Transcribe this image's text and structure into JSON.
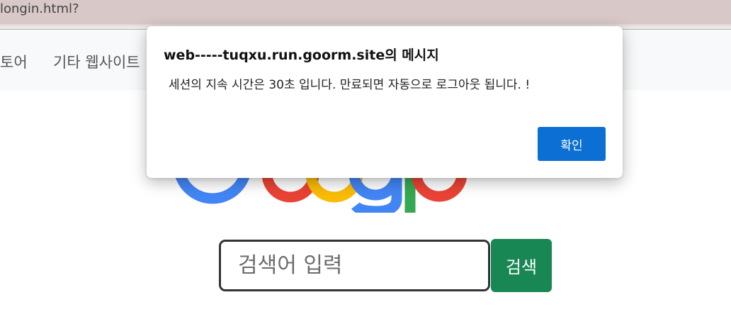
{
  "browser": {
    "address_text": "longin.html?"
  },
  "navbar": {
    "items": [
      {
        "label": "토어"
      },
      {
        "label": "기타 웹사이트"
      }
    ]
  },
  "logo": {
    "name": "Google",
    "colors": {
      "blue": "#4285F4",
      "red": "#EA4335",
      "yellow": "#FBBC05",
      "green": "#34A853"
    }
  },
  "search": {
    "placeholder": "검색어 입력",
    "value": "",
    "button_label": "검색",
    "button_color": "#198754"
  },
  "dialog": {
    "title": "web-----tuqxu.run.goorm.site의 메시지",
    "message": "세션의 지속 시간은 30초 입니다. 만료되면 자동으로 로그아웃 됩니다. !",
    "ok_label": "확인",
    "ok_color": "#0B6FD3"
  }
}
